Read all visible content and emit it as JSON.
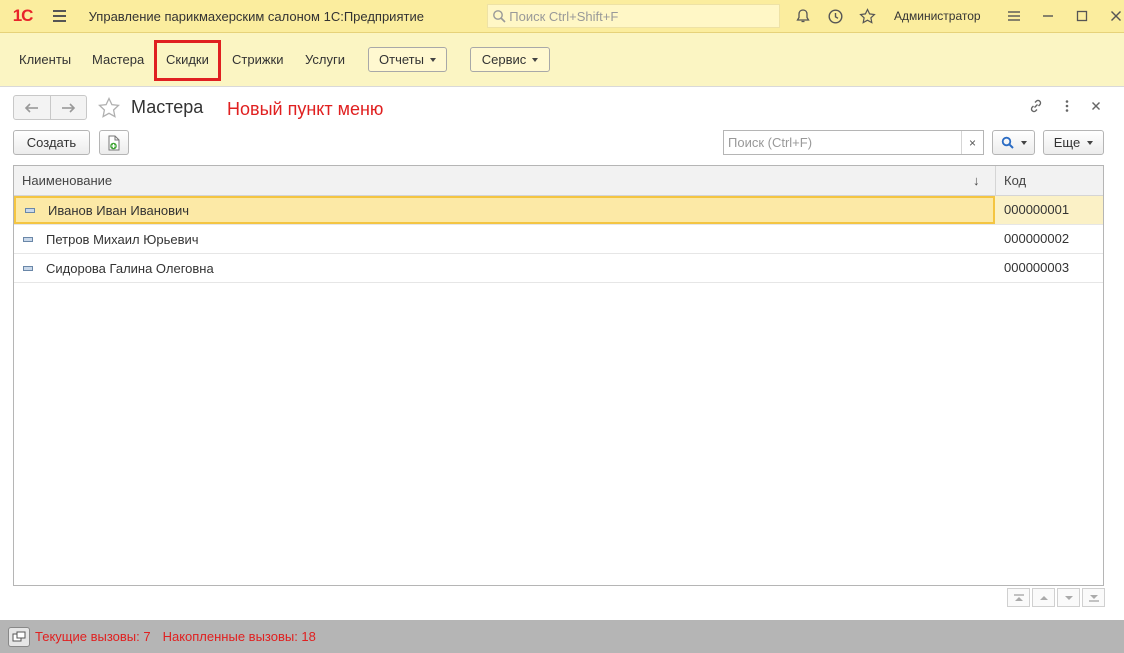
{
  "window": {
    "logo": "1С",
    "title": "Управление парикмахерским салоном 1С:Предприятие",
    "search_placeholder": "Поиск Ctrl+Shift+F",
    "user": "Администратор"
  },
  "sections": {
    "items": [
      {
        "label": "Клиенты"
      },
      {
        "label": "Мастера"
      },
      {
        "label": "Скидки",
        "highlighted": true
      },
      {
        "label": "Стрижки"
      },
      {
        "label": "Услуги"
      }
    ],
    "reports_label": "Отчеты",
    "service_label": "Сервис",
    "highlight_color": "#e02020"
  },
  "form": {
    "title": "Мастера",
    "annotation": "Новый пункт меню",
    "create_label": "Создать",
    "find_placeholder": "Поиск (Ctrl+F)",
    "find_clear": "×",
    "more_label": "Еще"
  },
  "table": {
    "columns": {
      "name": "Наименование",
      "sort_indicator": "↓",
      "code": "Код"
    },
    "rows": [
      {
        "name": "Иванов Иван Иванович",
        "code": "000000001",
        "selected": true
      },
      {
        "name": "Петров Михаил Юрьевич",
        "code": "000000002"
      },
      {
        "name": "Сидорова Галина Олеговна",
        "code": "000000003"
      }
    ]
  },
  "status": {
    "current_calls": "Текущие вызовы: 7",
    "accumulated_calls": "Накопленные вызовы: 18"
  },
  "colors": {
    "titlebar": "#fbed9e",
    "section_panel": "#fbf5c3",
    "selected_row": "#fce9a6",
    "accent_red": "#e02020"
  }
}
